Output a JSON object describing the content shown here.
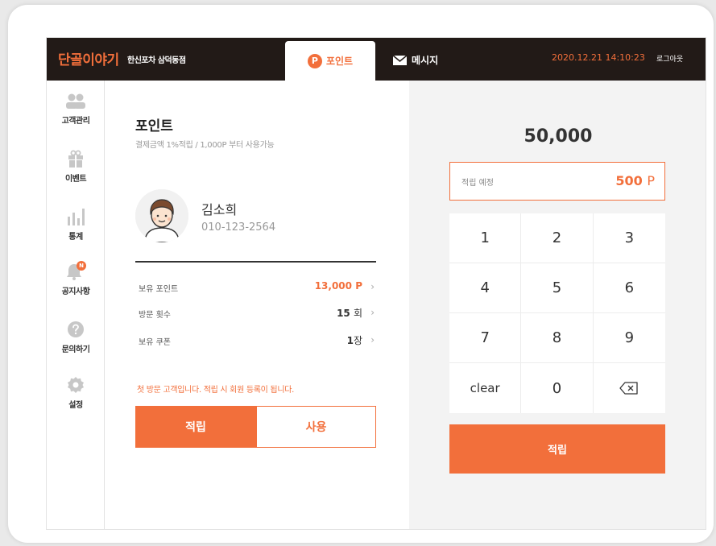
{
  "header": {
    "brand": "단골이야기",
    "store": "한신포차 삼덕동점",
    "tab_point_badge": "P",
    "tab_point_label": "포인트",
    "tab_message_label": "메시지",
    "datetime": "2020.12.21 14:10:23",
    "logout": "로그아웃"
  },
  "sidebar": {
    "items": [
      {
        "label": "고객관리",
        "icon": "customers-icon"
      },
      {
        "label": "이벤트",
        "icon": "gift-icon"
      },
      {
        "label": "통계",
        "icon": "chart-icon"
      },
      {
        "label": "공지사항",
        "icon": "bell-icon",
        "badge": "N"
      },
      {
        "label": "문의하기",
        "icon": "question-icon"
      },
      {
        "label": "설정",
        "icon": "gear-icon"
      }
    ]
  },
  "point_panel": {
    "title": "포인트",
    "subtitle": "결제금액 1%적립 / 1,000P 부터 사용가능",
    "customer": {
      "name": "김소희",
      "phone": "010-123-2564"
    },
    "stats": [
      {
        "label": "보유 포인트",
        "value": "13,000",
        "unit": "P"
      },
      {
        "label": "방문 횟수",
        "value": "15",
        "unit": "회"
      },
      {
        "label": "보유 쿠폰",
        "value": "1",
        "unit": "장"
      }
    ],
    "notice": "첫 방문 고객입니다. 적립 시 회원 등록이 됩니다.",
    "earn_button": "적립",
    "use_button": "사용"
  },
  "keypad_panel": {
    "amount": "50,000",
    "earn_label": "적립 예정",
    "earn_value": "500",
    "earn_unit": "P",
    "keys": [
      "1",
      "2",
      "3",
      "4",
      "5",
      "6",
      "7",
      "8",
      "9",
      "clear",
      "0",
      "backspace-icon"
    ],
    "submit": "적립"
  },
  "colors": {
    "accent": "#f26f3b",
    "header_bg": "#221a17",
    "panel_bg": "#f3f3f3"
  }
}
